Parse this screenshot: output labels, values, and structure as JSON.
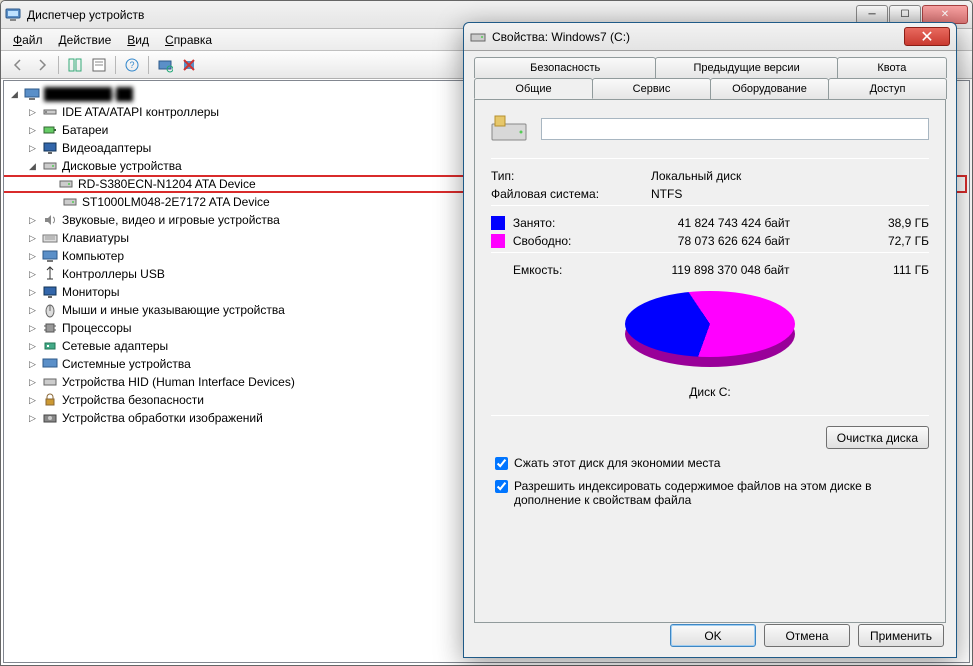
{
  "device_manager": {
    "title": "Диспетчер устройств",
    "menu": {
      "file": "Файл",
      "action": "Действие",
      "view": "Вид",
      "help": "Справка"
    },
    "tree": {
      "root_blur": "████████-██",
      "ide": "IDE ATA/ATAPI контроллеры",
      "batteries": "Батареи",
      "video": "Видеоадаптеры",
      "disks": "Дисковые устройства",
      "disk_children": [
        "RD-S380ECN-N1204 ATA Device",
        "ST1000LM048-2E7172 ATA Device"
      ],
      "sound": "Звуковые, видео и игровые устройства",
      "keyboards": "Клавиатуры",
      "computer": "Компьютер",
      "usb": "Контроллеры USB",
      "monitors": "Мониторы",
      "mice": "Мыши и иные указывающие устройства",
      "cpu": "Процессоры",
      "net": "Сетевые адаптеры",
      "system": "Системные устройства",
      "hid": "Устройства HID (Human Interface Devices)",
      "security": "Устройства безопасности",
      "imaging": "Устройства обработки изображений"
    }
  },
  "properties": {
    "title": "Свойства: Windows7 (C:)",
    "tabs_back": [
      "Безопасность",
      "Предыдущие версии",
      "Квота"
    ],
    "tabs_front": [
      "Общие",
      "Сервис",
      "Оборудование",
      "Доступ"
    ],
    "active_tab": "Общие",
    "drive_name": "",
    "type_label": "Тип:",
    "type_value": "Локальный диск",
    "fs_label": "Файловая система:",
    "fs_value": "NTFS",
    "used_label": "Занято:",
    "used_bytes": "41 824 743 424 байт",
    "used_hr": "38,9 ГБ",
    "free_label": "Свободно:",
    "free_bytes": "78 073 626 624 байт",
    "free_hr": "72,7 ГБ",
    "capacity_label": "Емкость:",
    "capacity_bytes": "119 898 370 048 байт",
    "capacity_hr": "111 ГБ",
    "disk_caption": "Диск C:",
    "cleanup_btn": "Очистка диска",
    "compress_label": "Сжать этот диск для экономии места",
    "index_label": "Разрешить индексировать содержимое файлов на этом диске в дополнение к свойствам файла",
    "buttons": {
      "ok": "OK",
      "cancel": "Отмена",
      "apply": "Применить"
    }
  },
  "chart_data": {
    "type": "pie",
    "title": "Диск C:",
    "series": [
      {
        "name": "Занято",
        "value": 41824743424,
        "hr": "38,9 ГБ",
        "color": "#0000ff"
      },
      {
        "name": "Свободно",
        "value": 78073626624,
        "hr": "72,7 ГБ",
        "color": "#ff00ff"
      }
    ],
    "total": {
      "label": "Емкость",
      "value": 119898370048,
      "hr": "111 ГБ"
    }
  }
}
